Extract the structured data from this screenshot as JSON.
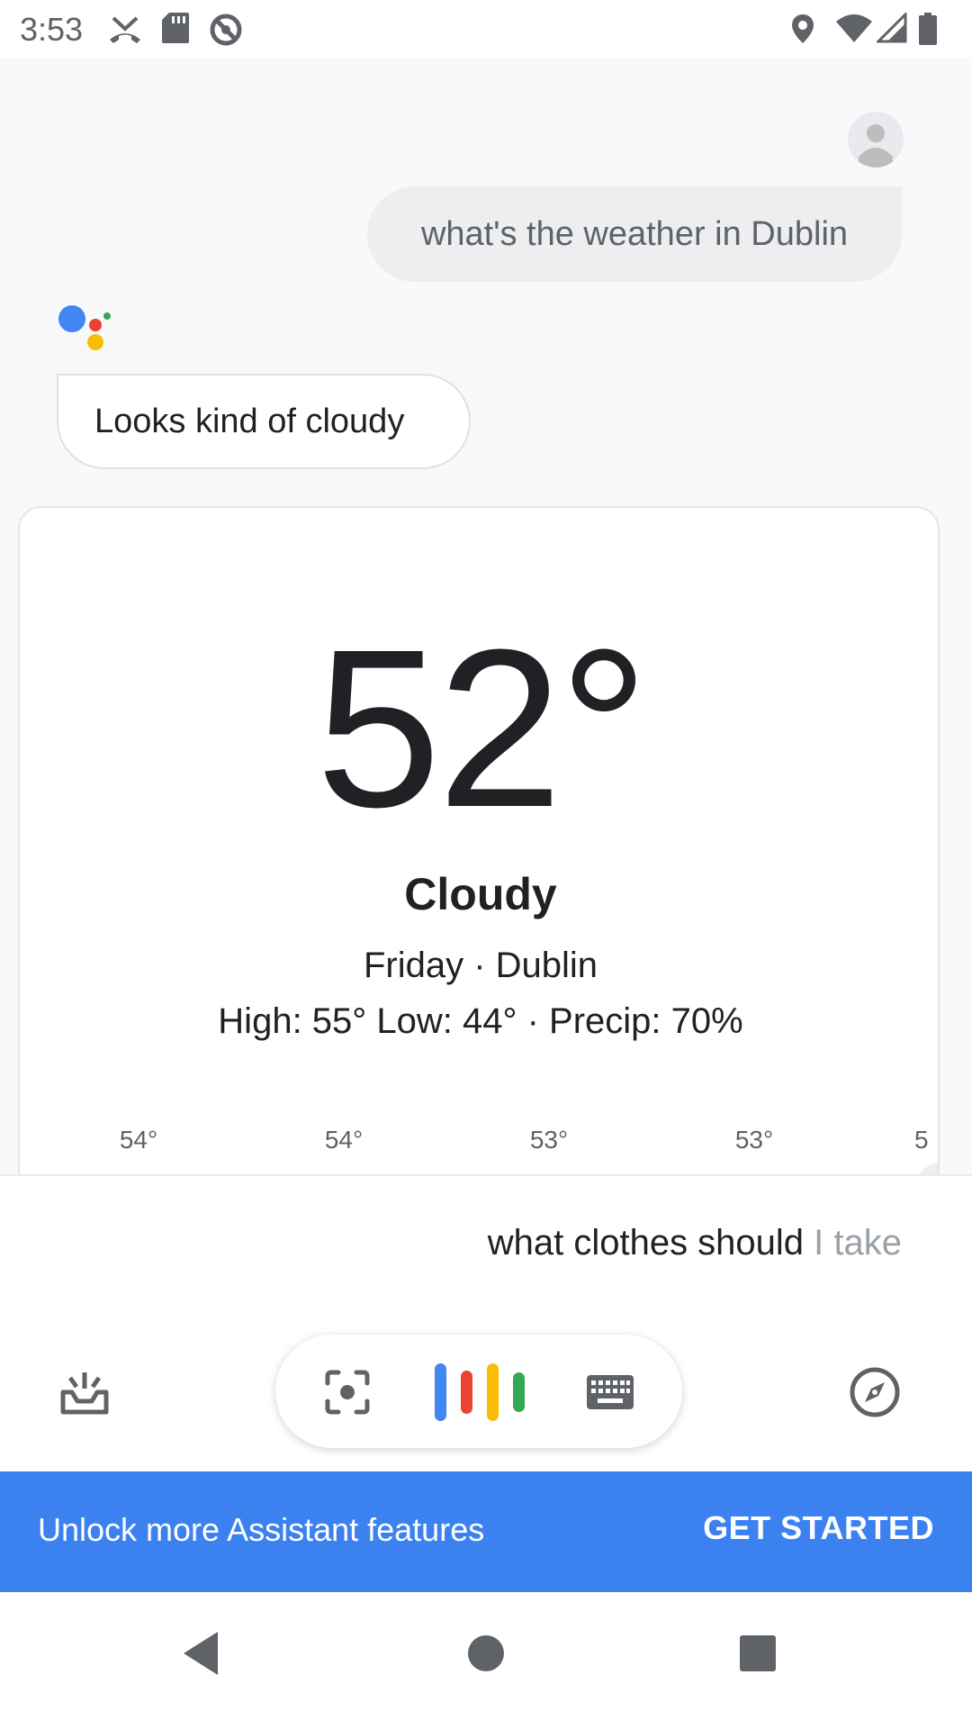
{
  "status_bar": {
    "time": "3:53",
    "left_icons": [
      "missed-call-icon",
      "sd-card-icon",
      "do-not-disturb-icon"
    ],
    "right_icons": [
      "location-icon",
      "wifi-icon",
      "cellular-icon",
      "battery-icon"
    ]
  },
  "conversation": {
    "user_query": "what's the weather in Dublin",
    "assistant_reply": "Looks kind of cloudy"
  },
  "weather": {
    "temperature": "52°",
    "condition": "Cloudy",
    "day_city": "Friday · Dublin",
    "details": "High: 55° Low: 44° · Precip: 70%",
    "hourly": [
      {
        "temp": "54°"
      },
      {
        "temp": "54°"
      },
      {
        "temp": "53°"
      },
      {
        "temp": "53°"
      },
      {
        "temp": "5"
      }
    ]
  },
  "input": {
    "query_confirmed": "what clothes should",
    "query_partial": " I take"
  },
  "toolbar": {
    "left_icon": "updates-tray-icon",
    "lens_icon": "lens-icon",
    "mic_icon": "assistant-mic-icon",
    "keyboard_icon": "keyboard-icon",
    "right_icon": "explore-compass-icon"
  },
  "banner": {
    "text": "Unlock more Assistant features",
    "cta": "GET STARTED"
  },
  "colors": {
    "banner_blue": "#3b82f0",
    "google_blue": "#4285f4",
    "google_red": "#ea4335",
    "google_yellow": "#fbbc04",
    "google_green": "#34a853"
  }
}
